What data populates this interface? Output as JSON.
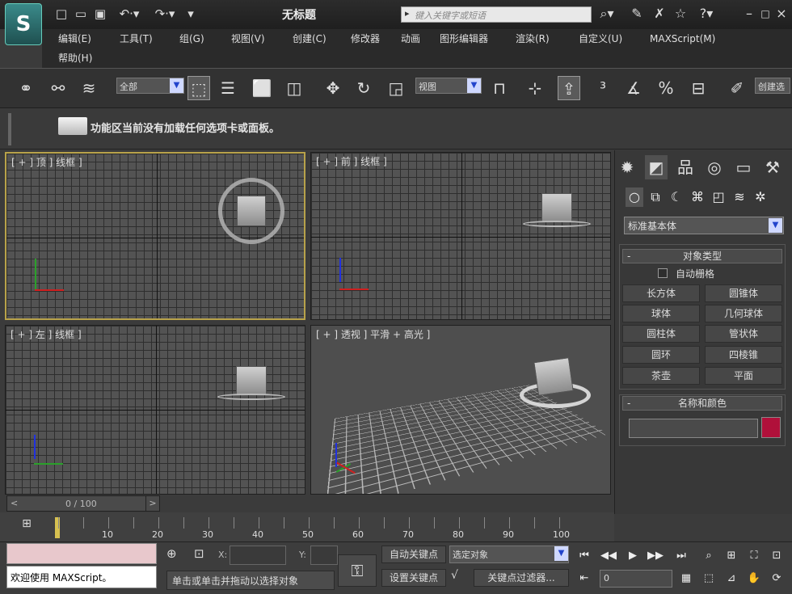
{
  "app": {
    "title": "无标题",
    "logo": "3ds-max-logo"
  },
  "search": {
    "placeholder": "键入关键字或短语"
  },
  "menu": [
    "编辑(E)",
    "工具(T)",
    "组(G)",
    "视图(V)",
    "创建(C)",
    "修改器",
    "动画",
    "图形编辑器",
    "渲染(R)",
    "自定义(U)",
    "MAXScript(M)",
    "帮助(H)"
  ],
  "toolbar": {
    "filter_value": "全部",
    "refcoord_value": "视图",
    "named_sel_label": "创建选"
  },
  "ribbon": {
    "message": "功能区当前没有加载任何选项卡或面板。"
  },
  "viewports": {
    "top": "[ + ] 顶 ] 线框 ]",
    "front": "[ + ] 前 ] 线框 ]",
    "left": "[ + ] 左 ] 线框 ]",
    "persp": "[ + ] 透视 ] 平滑 + 高光 ]"
  },
  "command_panel": {
    "category": "标准基本体",
    "object_type_header": "对象类型",
    "autogrid": "自动栅格",
    "buttons": [
      "长方体",
      "圆锥体",
      "球体",
      "几何球体",
      "圆柱体",
      "管状体",
      "圆环",
      "四棱锥",
      "茶壶",
      "平面"
    ],
    "name_color_header": "名称和颜色",
    "object_color": "#b0103a"
  },
  "timeline": {
    "position": "0 / 100",
    "ticks": [
      "10",
      "20",
      "30",
      "40",
      "50",
      "60",
      "70",
      "80",
      "90",
      "100"
    ]
  },
  "status": {
    "listener_text": "欢迎使用 MAXScript。",
    "prompt": "单击或单击并拖动以选择对象",
    "x_label": "X:",
    "y_label": "Y:",
    "auto_key": "自动关键点",
    "set_key": "设置关键点",
    "selection": "选定对象",
    "key_filters": "关键点过滤器...",
    "frame": "0"
  }
}
